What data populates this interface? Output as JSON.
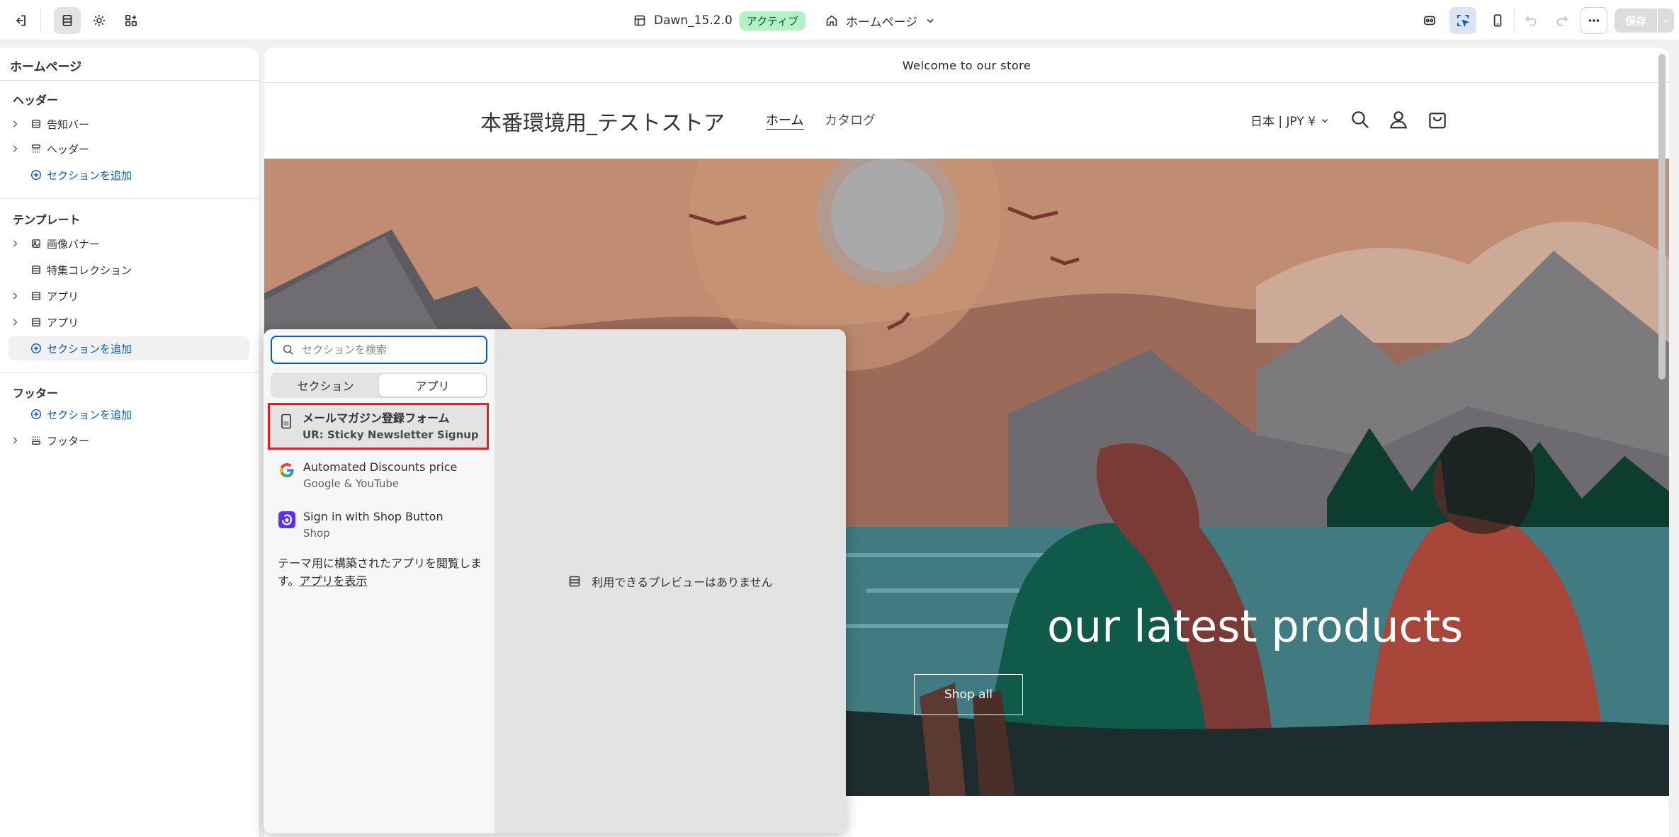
{
  "topbar": {
    "theme_name": "Dawn_15.2.0",
    "theme_status": "アクティブ",
    "page_selector": "ホームページ",
    "save_label": "保存"
  },
  "sidebar": {
    "title": "ホームページ",
    "header_group": {
      "label": "ヘッダー",
      "items": [
        "告知バー",
        "ヘッダー"
      ],
      "add_label": "セクションを追加"
    },
    "template_group": {
      "label": "テンプレート",
      "items": [
        "画像バナー",
        "特集コレクション",
        "アプリ",
        "アプリ"
      ],
      "add_label": "セクションを追加"
    },
    "footer_group": {
      "label": "フッター",
      "add_label": "セクションを追加",
      "items": [
        "フッター"
      ]
    }
  },
  "preview": {
    "announcement": "Welcome to our store",
    "store_name": "本番環境用_テストストア",
    "nav": [
      "ホーム",
      "カタログ"
    ],
    "locale": "日本 | JPY ¥",
    "hero_heading_partial": "our latest products",
    "hero_button": "Shop all"
  },
  "picker": {
    "search_placeholder": "セクションを検索",
    "tabs": [
      "セクション",
      "アプリ"
    ],
    "active_tab": "アプリ",
    "apps": [
      {
        "name": "メールマガジン登録フォーム",
        "vendor": "UR: Sticky Newsletter Signup",
        "icon": "phone-form-icon"
      },
      {
        "name": "Automated Discounts price",
        "vendor": "Google & YouTube",
        "icon": "google-icon"
      },
      {
        "name": "Sign in with Shop Button",
        "vendor": "Shop",
        "icon": "shop-icon"
      }
    ],
    "browse_text": "テーマ用に構築されたアプリを閲覧します。",
    "browse_link": "アプリを表示",
    "no_preview": "利用できるプレビューはありません"
  },
  "colors": {
    "accent": "#005bd3",
    "badge_bg": "#b4f2c5",
    "highlight_border": "#e51c23"
  }
}
